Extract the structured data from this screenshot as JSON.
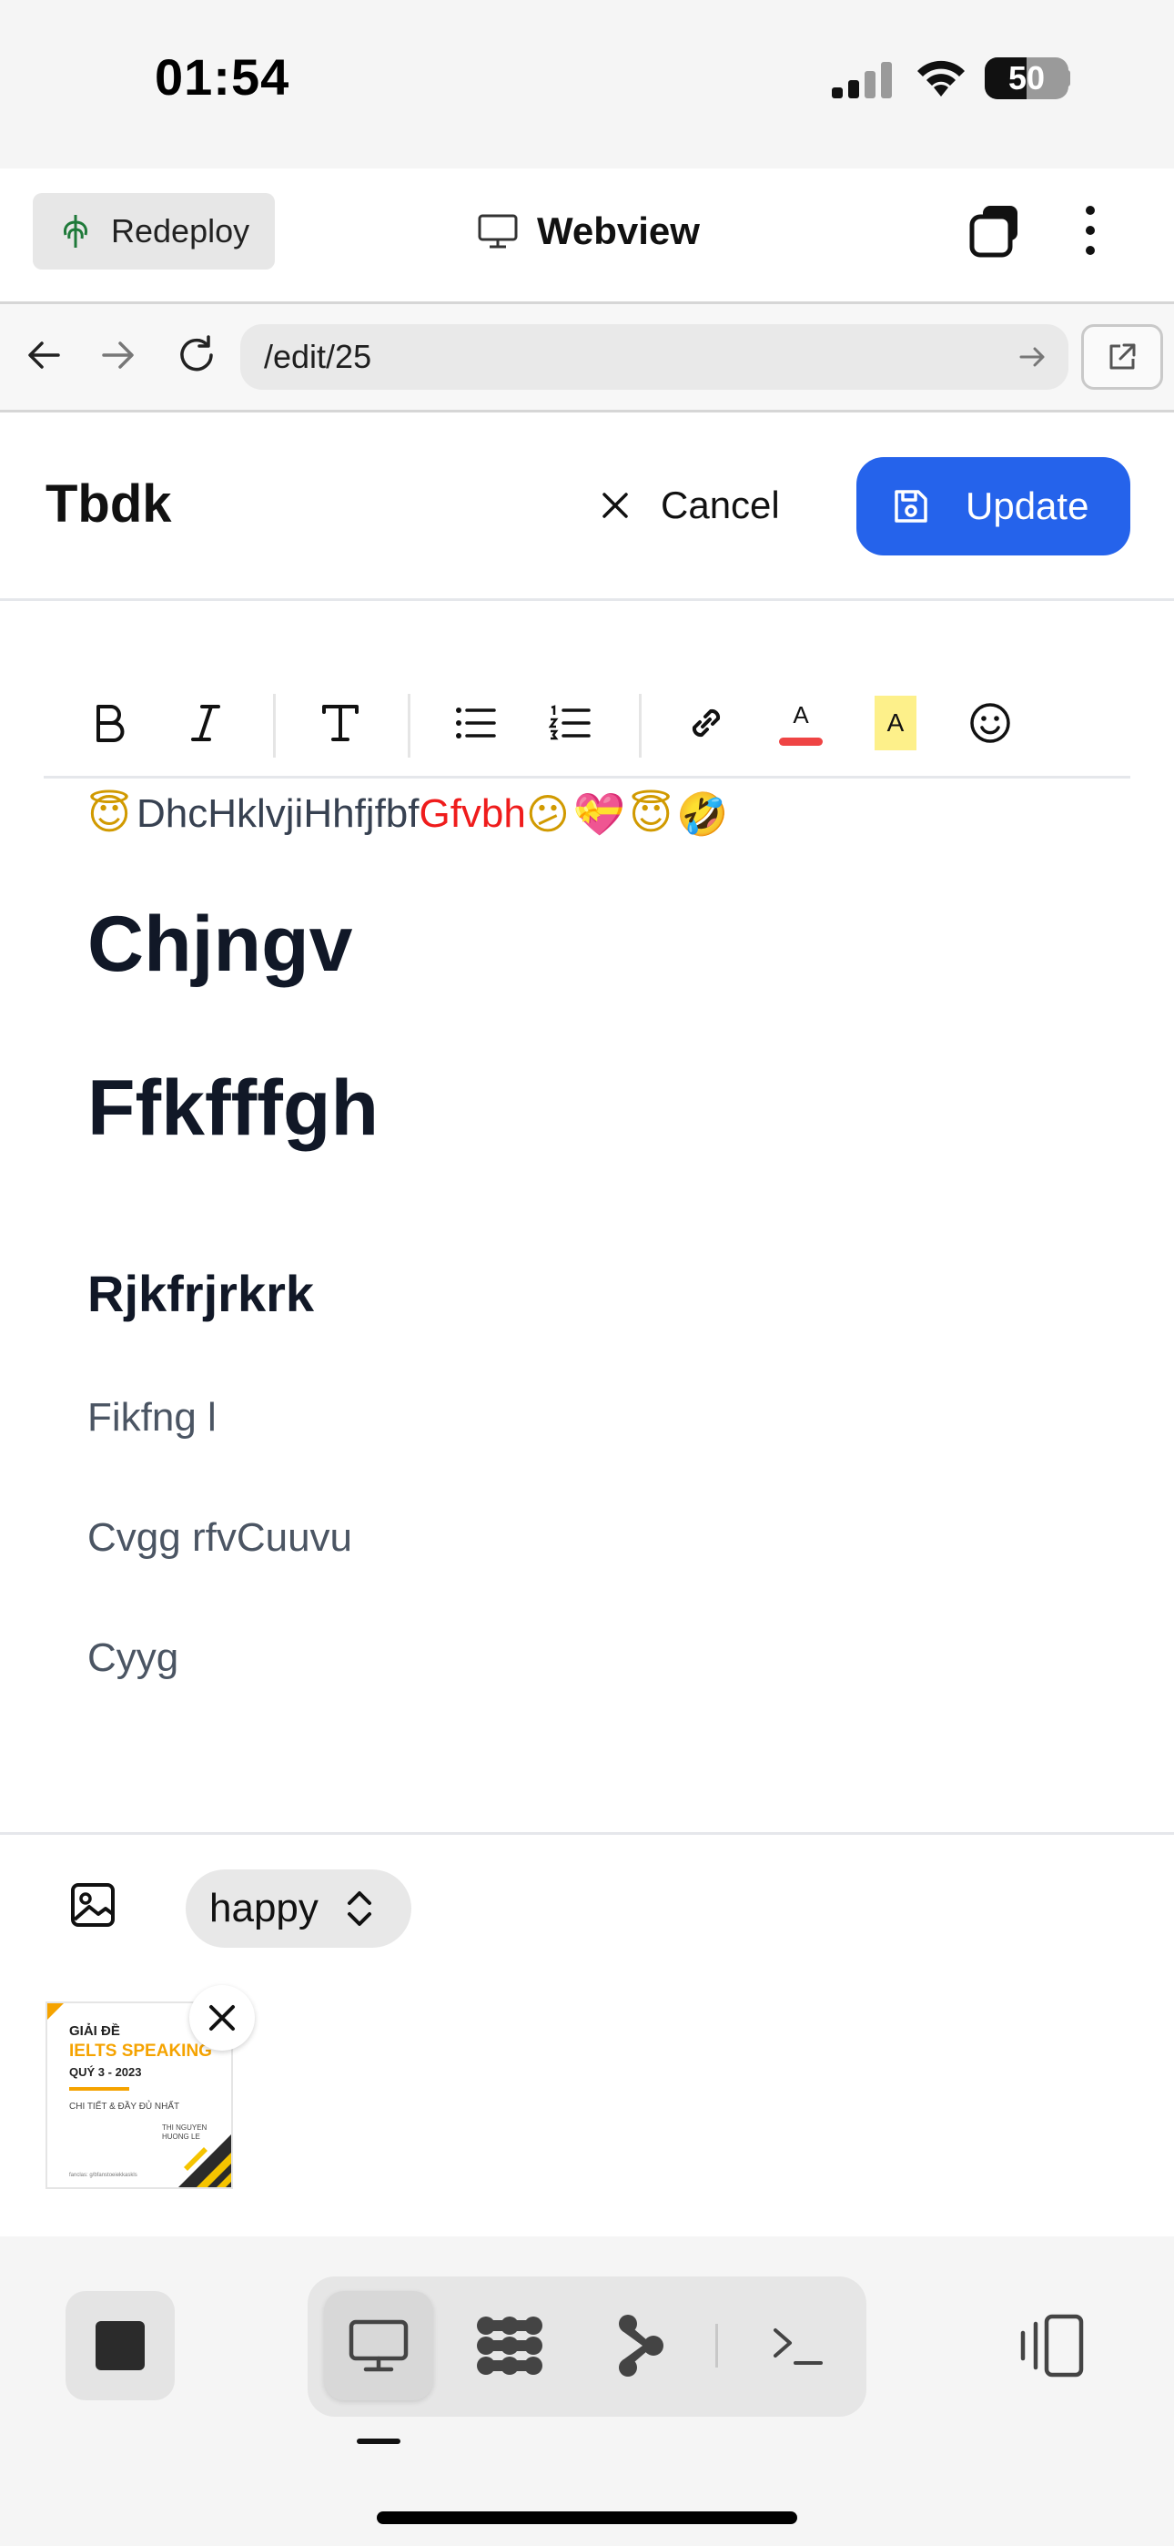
{
  "status_bar": {
    "time": "01:54",
    "battery_level": "50",
    "battery_fraction": 0.5
  },
  "app_header": {
    "redeploy_label": "Redeploy",
    "title": "Webview",
    "icons": [
      "redeploy-icon",
      "monitor-icon",
      "tabs-icon",
      "more-vertical-icon"
    ]
  },
  "browser": {
    "url": "/edit/25",
    "icons": [
      "back-arrow-icon",
      "forward-arrow-icon",
      "reload-icon",
      "go-arrow-icon",
      "open-external-icon"
    ]
  },
  "editor_header": {
    "title": "Tbdk",
    "cancel_label": "Cancel",
    "update_label": "Update",
    "icons": [
      "close-icon",
      "save-icon"
    ]
  },
  "toolbar": {
    "buttons": [
      "bold",
      "italic",
      "text-style",
      "bullet-list",
      "ordered-list",
      "link",
      "text-color",
      "highlight",
      "emoji"
    ],
    "text_color_letter": "A",
    "highlight_letter": "A",
    "colors": {
      "text_color_bar": "#ef4444",
      "highlight_bg": "#fdf08a"
    }
  },
  "document": {
    "line1_emoji_start": "😇",
    "line1_text": "DhcHklvjiHhfjfbf",
    "line1_red_text": "Gfvbh",
    "line1_emoji_end": "😕💝😇🤣",
    "heading1": "Chjngv",
    "heading2": "Ffkfffgh",
    "heading3": "Rjkfrjrkrk",
    "paragraphs": [
      "Fikfng l",
      "Cvgg rfvCuuvu",
      "Cyyg"
    ]
  },
  "attachments": {
    "mood_value": "happy",
    "thumbnail": {
      "line1": "GIẢI ĐỀ",
      "line2": "IELTS SPEAKING",
      "line3": "QUÝ 3 - 2023",
      "line4": "CHI TIẾT & ĐẦY ĐỦ NHẤT",
      "line5a": "THI NGUYEN",
      "line5b": "HUONG LE",
      "line6": "fanclas: g/bfanstoeiekkaskls"
    }
  },
  "dock": {
    "items": [
      "stop",
      "desktop-view",
      "grid-apps",
      "branch",
      "terminal",
      "side-panel"
    ],
    "active": "desktop-view"
  },
  "colors": {
    "accent": "#2563eb",
    "red_text": "#ef1c1c"
  }
}
